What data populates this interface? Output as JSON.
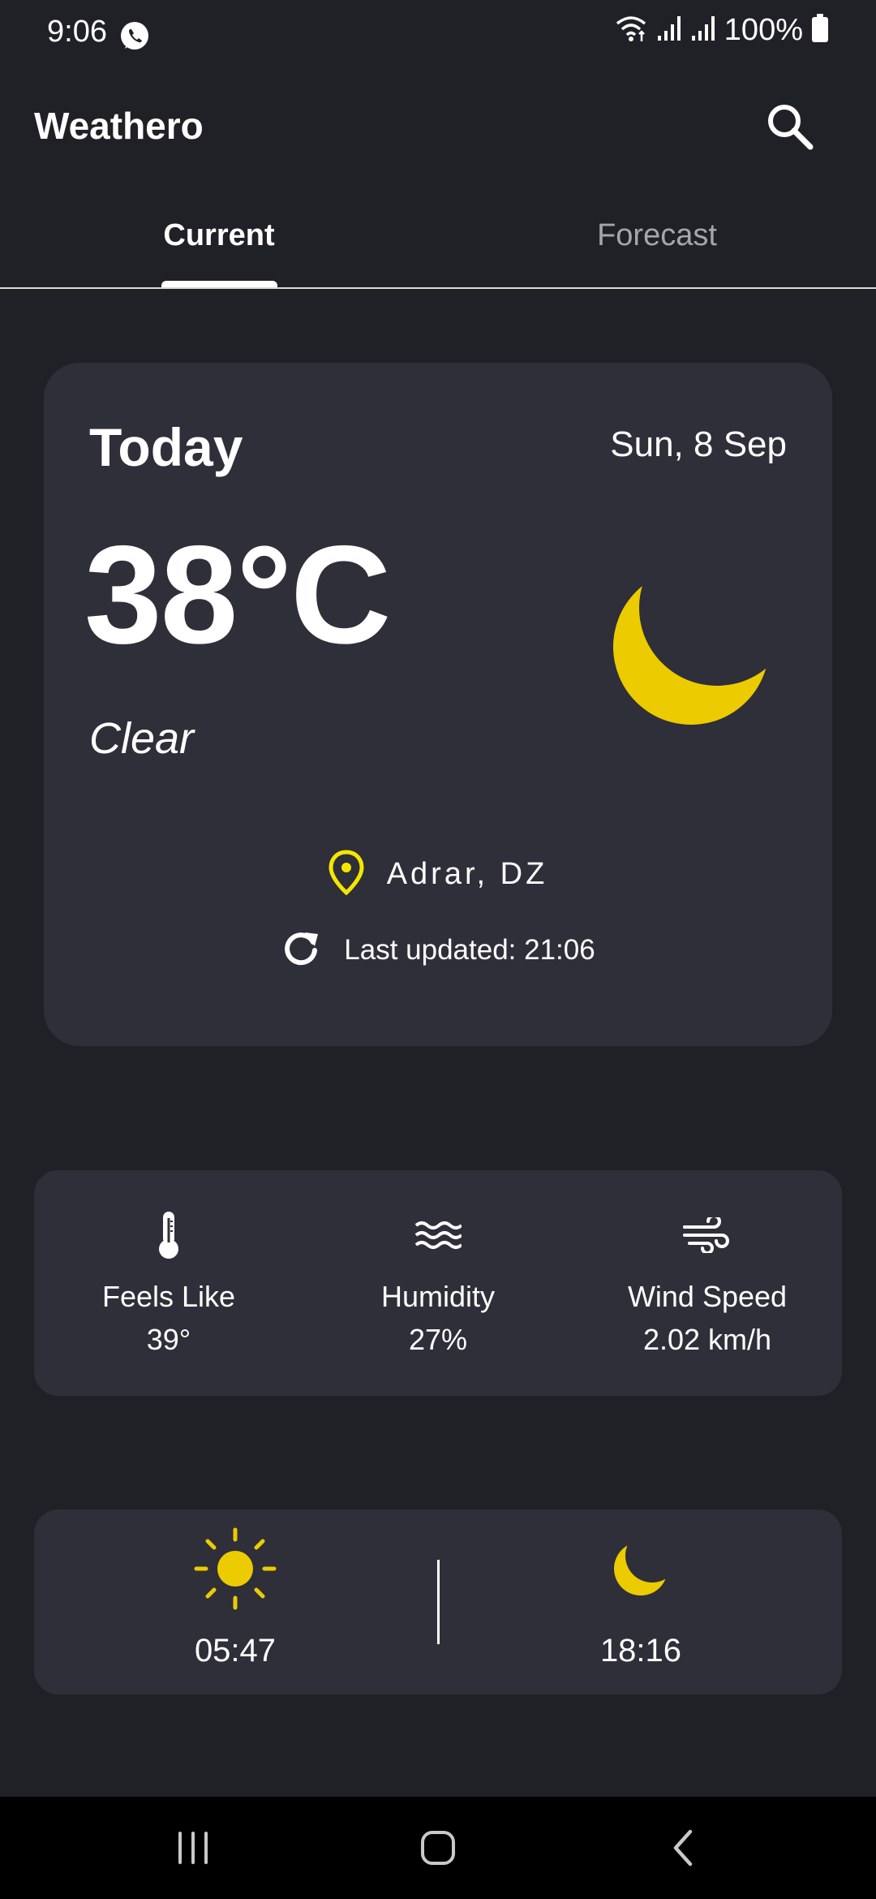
{
  "status_bar": {
    "time": "9:06",
    "battery": "100%",
    "icons": [
      "whatsapp-icon",
      "wifi-icon",
      "signal-icon",
      "signal-icon",
      "battery-icon"
    ]
  },
  "app_bar": {
    "title": "Weathero",
    "search_icon": "search-icon"
  },
  "tabs": [
    {
      "label": "Current",
      "selected": true
    },
    {
      "label": "Forecast",
      "selected": false
    }
  ],
  "today": {
    "label": "Today",
    "date": "Sun, 8 Sep",
    "temperature": "38°C",
    "condition": "Clear",
    "weather_icon": "moon-icon",
    "location": "Adrar, DZ",
    "last_updated": "Last updated: 21:06"
  },
  "details": [
    {
      "icon": "thermometer-icon",
      "label": "Feels Like",
      "value": "39°"
    },
    {
      "icon": "humidity-waves-icon",
      "label": "Humidity",
      "value": "27%"
    },
    {
      "icon": "wind-icon",
      "label": "Wind Speed",
      "value": "2.02 km/h"
    }
  ],
  "sun": {
    "sunrise": "05:47",
    "sunset": "18:16"
  },
  "colors": {
    "background": "#202126",
    "card": "#2e2f39",
    "accent_yellow": "#eccb00",
    "pin_yellow": "#f5e600",
    "tab_inactive": "#a5a6ab"
  },
  "nav_bar": {
    "items": [
      "recent-apps-icon",
      "home-icon",
      "back-icon"
    ]
  }
}
